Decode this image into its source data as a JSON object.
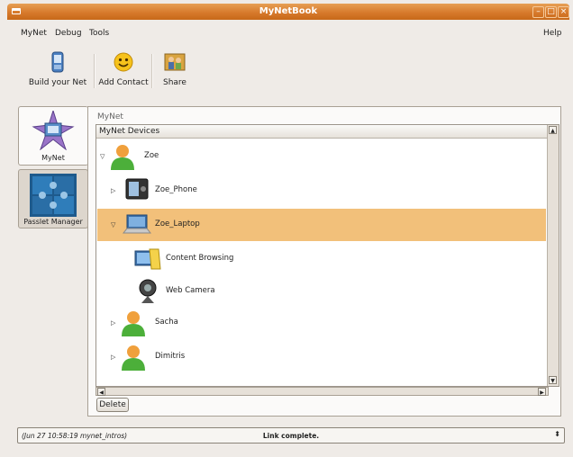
{
  "window": {
    "title": "MyNetBook",
    "minimize_glyph": "–",
    "maximize_glyph": "□",
    "close_glyph": "×"
  },
  "menu": {
    "mynet": "MyNet",
    "debug": "Debug",
    "tools": "Tools",
    "help": "Help"
  },
  "toolbar": {
    "build_net": "Build your Net",
    "add_contact": "Add Contact",
    "share": "Share"
  },
  "sidebar": {
    "mynet_label": "MyNet",
    "passlet_label": "Passlet Manager"
  },
  "panel": {
    "breadcrumb": "MyNet",
    "tree_header": "MyNet Devices"
  },
  "tree": {
    "zoe": "Zoe",
    "zoe_phone": "Zoe_Phone",
    "zoe_laptop": "Zoe_Laptop",
    "content_browsing": "Content Browsing",
    "web_camera": "Web Camera",
    "sacha": "Sacha",
    "dimitris": "Dimitris"
  },
  "actions": {
    "delete": "Delete"
  },
  "status": {
    "left": "(Jun 27 10:58:19 mynet_intros)",
    "center": "Link complete.",
    "spinner": "⬍"
  },
  "colors": {
    "titlebar": "#d77a2c",
    "selection": "#f2c07a"
  },
  "icons": {
    "build": "device-icon",
    "add": "smiley-icon",
    "share": "people-icon",
    "person": "person-icon",
    "phone": "phone-icon",
    "laptop": "laptop-icon",
    "browse": "browser-icon",
    "camera": "webcam-icon"
  }
}
